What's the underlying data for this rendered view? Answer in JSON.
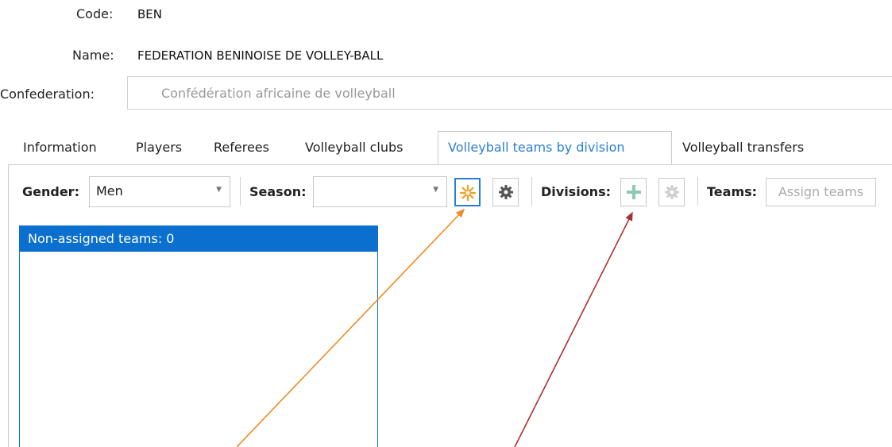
{
  "header": {
    "code_label": "Code:",
    "code_value": "BEN",
    "name_label": "Name:",
    "name_value": "FEDERATION BENINOISE DE VOLLEY-BALL",
    "confederation_label": "Confederation:",
    "confederation_value": "Confédération africaine de volleyball"
  },
  "tabs": [
    {
      "label": "Information"
    },
    {
      "label": "Players"
    },
    {
      "label": "Referees"
    },
    {
      "label": "Volleyball clubs"
    },
    {
      "label": "Volleyball teams by division",
      "active": true
    },
    {
      "label": "Volleyball transfers"
    }
  ],
  "toolbar": {
    "gender_label": "Gender:",
    "gender_value": "Men",
    "season_label": "Season:",
    "season_value": "",
    "season_new_icon": "sun-star-icon",
    "season_settings_icon": "gear-icon",
    "divisions_label": "Divisions:",
    "divisions_add_icon": "plus-icon",
    "divisions_settings_icon": "gear-icon",
    "teams_label": "Teams:",
    "assign_teams_label": "Assign teams"
  },
  "list": {
    "header": "Non-assigned teams: 0"
  },
  "colors": {
    "accent": "#0a6fcf",
    "tab_active_text": "#2b7fd3",
    "arrow_orange": "#f08a24",
    "arrow_red": "#a83232",
    "sun_icon": "#f0a020",
    "plus_icon": "#8fc9b3"
  }
}
